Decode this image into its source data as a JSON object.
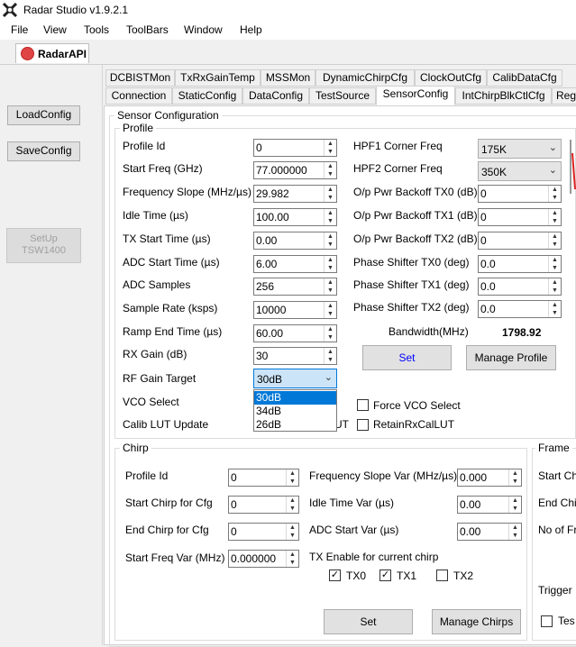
{
  "window": {
    "title": "Radar Studio v1.9.2.1"
  },
  "menu": [
    "File",
    "View",
    "Tools",
    "ToolBars",
    "Window",
    "Help"
  ],
  "doc_tab": {
    "label": "RadarAPI"
  },
  "left_panel": {
    "load_config": "LoadConfig",
    "save_config": "SaveConfig",
    "setup_line1": "SetUp",
    "setup_line2": "TSW1400"
  },
  "tabs_row1": [
    "DCBISTMon",
    "TxRxGainTemp",
    "MSSMon",
    "DynamicChirpCfg",
    "ClockOutCfg",
    "CalibDataCfg"
  ],
  "tabs_row2": [
    "Connection",
    "StaticConfig",
    "DataConfig",
    "TestSource",
    "SensorConfig",
    "IntChirpBlkCtlCfg",
    "Reg"
  ],
  "sensor": {
    "title": "Sensor Configuration",
    "profile": {
      "title": "Profile",
      "fields": [
        {
          "label": "Profile Id",
          "value": "0"
        },
        {
          "label": "Start Freq (GHz)",
          "value": "77.000000"
        },
        {
          "label": "Frequency Slope (MHz/µs)",
          "value": "29.982"
        },
        {
          "label": "Idle Time (µs)",
          "value": "100.00"
        },
        {
          "label": "TX Start Time (µs)",
          "value": "0.00"
        },
        {
          "label": "ADC Start Time (µs)",
          "value": "6.00"
        },
        {
          "label": "ADC Samples",
          "value": "256"
        },
        {
          "label": "Sample Rate (ksps)",
          "value": "10000"
        },
        {
          "label": "Ramp End Time (µs)",
          "value": "60.00"
        },
        {
          "label": "RX Gain (dB)",
          "value": "30"
        }
      ],
      "rf_gain_label": "RF Gain Target",
      "rf_gain_value": "30dB",
      "rf_gain_options": [
        "30dB",
        "34dB",
        "26dB"
      ],
      "vco_label": "VCO Select",
      "calib_label": "Calib LUT Update",
      "calib_partial": "UT",
      "hpf1_label": "HPF1 Corner Freq",
      "hpf1_value": "175K",
      "hpf2_label": "HPF2 Corner Freq",
      "hpf2_value": "350K",
      "right_fields": [
        {
          "label": "O/p Pwr Backoff TX0 (dB)",
          "value": "0"
        },
        {
          "label": "O/p Pwr Backoff TX1 (dB)",
          "value": "0"
        },
        {
          "label": "O/p Pwr Backoff TX2 (dB)",
          "value": "0"
        },
        {
          "label": "Phase Shifter TX0 (deg)",
          "value": "0.0"
        },
        {
          "label": "Phase Shifter TX1 (deg)",
          "value": "0.0"
        },
        {
          "label": "Phase Shifter TX2 (deg)",
          "value": "0.0"
        }
      ],
      "bandwidth_label": "Bandwidth(MHz)",
      "bandwidth_value": "1798.92",
      "set_label": "Set",
      "manage_label": "Manage Profile",
      "force_vco": "Force VCO Select",
      "retain_rx": "RetainRxCalLUT"
    },
    "chirp": {
      "title": "Chirp",
      "left_fields": [
        {
          "label": "Profile Id",
          "value": "0"
        },
        {
          "label": "Start Chirp for Cfg",
          "value": "0"
        },
        {
          "label": "End Chirp for Cfg",
          "value": "0"
        },
        {
          "label": "Start Freq Var (MHz)",
          "value": "0.000000"
        }
      ],
      "right_fields": [
        {
          "label": "Frequency Slope Var (MHz/µs)",
          "value": "0.000"
        },
        {
          "label": "Idle Time Var (µs)",
          "value": "0.00"
        },
        {
          "label": "ADC Start Var (µs)",
          "value": "0.00"
        }
      ],
      "tx_enable_label": "TX Enable for current chirp",
      "tx0": "TX0",
      "tx1": "TX1",
      "tx2": "TX2",
      "set_label": "Set",
      "manage_label": "Manage Chirps"
    },
    "frame": {
      "title": "Frame",
      "start_chirp": "Start Ch",
      "end_chirp": "End Chi",
      "no_of": "No of Fr",
      "trigger": "Trigger",
      "test": "Tes"
    }
  },
  "colors": {
    "accent": "#0078d7",
    "link_blue": "#0000ff"
  }
}
